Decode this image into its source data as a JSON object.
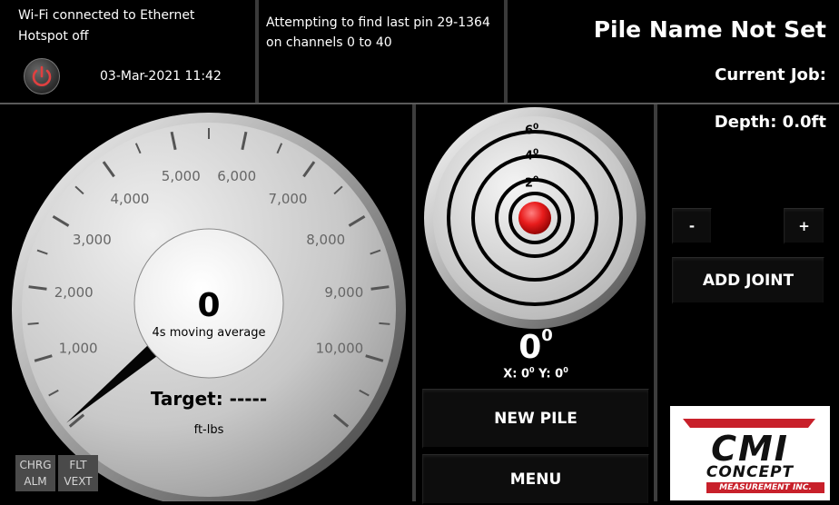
{
  "status": {
    "wifi": "Wi-Fi connected to Ethernet",
    "hotspot": "Hotspot off",
    "datetime": "03-Mar-2021 11:42"
  },
  "message": {
    "line1": "Attempting to find last pin 29-1364",
    "line2": "on channels 0 to 40"
  },
  "pile": {
    "name": "Pile Name Not Set",
    "current_job_label": "Current Job:",
    "depth_label": "Depth: 0.0ft"
  },
  "gauge": {
    "value": "0",
    "value_numeric": 0,
    "subtitle": "4s moving average",
    "target_label": "Target: -----",
    "unit": "ft-lbs",
    "scale_labels": [
      "1,000",
      "2,000",
      "3,000",
      "4,000",
      "5,000",
      "6,000",
      "7,000",
      "8,000",
      "9,000",
      "10,000"
    ]
  },
  "tilt": {
    "ring_labels": [
      "6",
      "4",
      "2"
    ],
    "degree_symbol": "0",
    "angle": "0",
    "xy_x_label": "X: 0",
    "xy_y_label": " Y: 0",
    "bubble_color": "#e81c1c"
  },
  "buttons": {
    "minus": "-",
    "plus": "+",
    "add_joint": "ADD JOINT",
    "new_pile": "NEW PILE",
    "menu": "MENU"
  },
  "indicators": {
    "chrg": "CHRG",
    "alm": "ALM",
    "flt": "FLT",
    "vext": "VEXT"
  },
  "logo": {
    "mark": "CMI",
    "line1": "CONCEPT",
    "line2": "MEASUREMENT INC."
  },
  "colors": {
    "accent_red": "#c8202a",
    "background": "#000000"
  }
}
